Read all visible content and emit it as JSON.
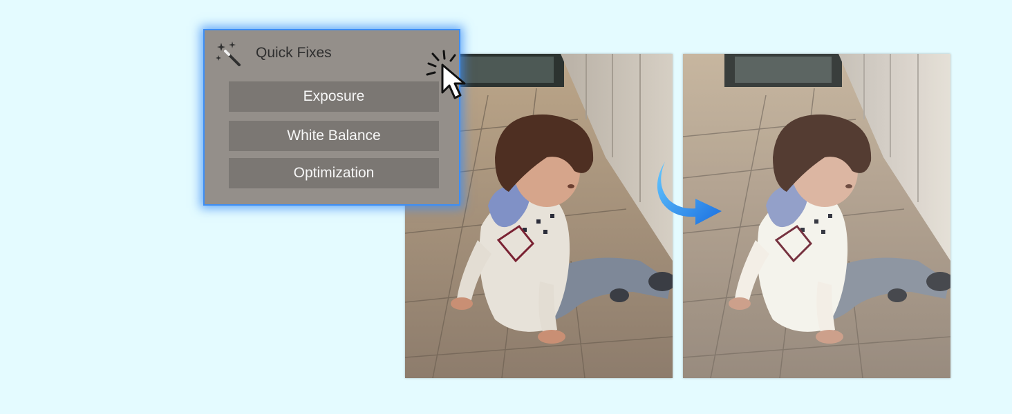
{
  "panel": {
    "title": "Quick Fixes",
    "icon": "magic-wand-icon",
    "buttons": [
      {
        "label": "Exposure"
      },
      {
        "label": "White Balance"
      },
      {
        "label": "Optimization"
      }
    ]
  },
  "colors": {
    "background": "#e4fbff",
    "panel_bg": "#948f8a",
    "panel_border": "#3d8ef5",
    "button_bg": "#7b7773",
    "button_text": "#f6f6f6",
    "arrow_blue": "#2e8df0"
  },
  "images": {
    "before": "original-photo-child-sitting-on-pavement",
    "after": "quick-fixed-photo-child-sitting-on-pavement"
  },
  "icons": {
    "transform": "curved-arrow-icon",
    "pointer": "mouse-cursor-icon"
  }
}
